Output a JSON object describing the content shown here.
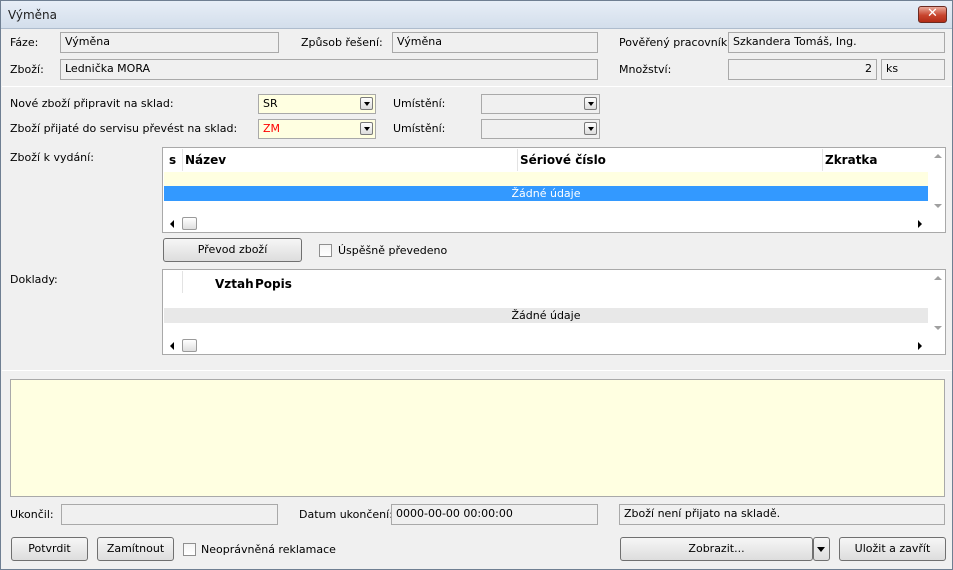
{
  "window": {
    "title": "Výměna"
  },
  "header": {
    "faze_label": "Fáze:",
    "faze_value": "Výměna",
    "zpusob_label": "Způsob řešení:",
    "zpusob_value": "Výměna",
    "pracovnik_label": "Pověřený pracovník:",
    "pracovnik_value": "Szkandera Tomáš, Ing.",
    "zbozi_label": "Zboží:",
    "zbozi_value": "Lednička MORA",
    "mnozstvi_label": "Množství:",
    "mnozstvi_value": "2",
    "mnozstvi_unit": "ks"
  },
  "sklad": {
    "nove_label": "Nové zboží připravit na sklad:",
    "nove_value": "SR",
    "umisteni1_label": "Umístění:",
    "umisteni1_value": "",
    "prijate_label": "Zboží přijaté do servisu převést na sklad:",
    "prijate_value": "ZM",
    "umisteni2_label": "Umístění:",
    "umisteni2_value": ""
  },
  "vydani": {
    "label": "Zboží k vydání:",
    "columns": [
      "s",
      "Název",
      "Sériové číslo",
      "Zkratka"
    ],
    "empty_text": "Žádné údaje"
  },
  "prevod": {
    "button": "Převod zboží",
    "checkbox_label": "Úspěšně převedeno"
  },
  "doklady": {
    "label": "Doklady:",
    "columns": [
      "Vztah",
      "Popis"
    ],
    "empty_text": "Žádné údaje"
  },
  "footer": {
    "ukoncil_label": "Ukončil:",
    "ukoncil_value": "",
    "datum_label": "Datum ukončení:",
    "datum_value": "0000-00-00 00:00:00",
    "stav_value": "Zboží není přijato na skladě."
  },
  "buttons": {
    "potvrdit": "Potvrdit",
    "zamitnout": "Zamítnout",
    "neopravnena": "Neoprávněná reklamace",
    "zobrazit": "Zobrazit...",
    "ulozit": "Uložit a zavřít"
  },
  "colors": {
    "selected_row": "#3399ff",
    "zm_text": "#ff0000",
    "yellow_bg": "#ffffe1"
  },
  "icons": [
    "close-icon",
    "dropdown-arrow-icon",
    "scroll-left-icon",
    "scroll-right-icon",
    "scroll-up-icon",
    "scroll-down-icon",
    "checkbox-icon"
  ]
}
